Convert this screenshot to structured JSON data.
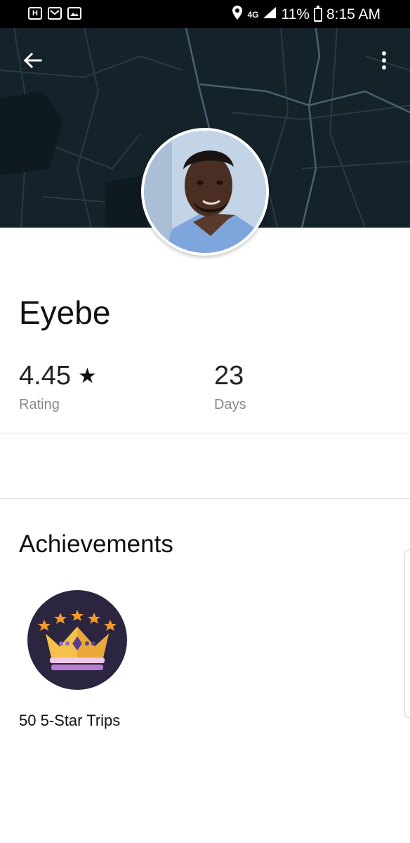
{
  "status_bar": {
    "notifications": [
      "H",
      "gmail-icon",
      "image-icon"
    ],
    "network": "4G",
    "battery": "11%",
    "time": "8:15 AM"
  },
  "header": {
    "back_icon": "arrow-left-icon",
    "menu_icon": "more-vert-icon"
  },
  "profile": {
    "name": "Eyebe",
    "stats": [
      {
        "value": "4.45",
        "label": "Rating",
        "icon": "star-icon"
      },
      {
        "value": "23",
        "label": "Days"
      }
    ]
  },
  "achievements": {
    "title": "Achievements",
    "items": [
      {
        "label": "50 5-Star Trips",
        "icon": "crown-icon"
      }
    ]
  },
  "colors": {
    "header_bg": "#14222a",
    "badge_bg": "#2c2540",
    "crown_gold": "#f4c24c",
    "star_orange": "#f39a2a"
  }
}
